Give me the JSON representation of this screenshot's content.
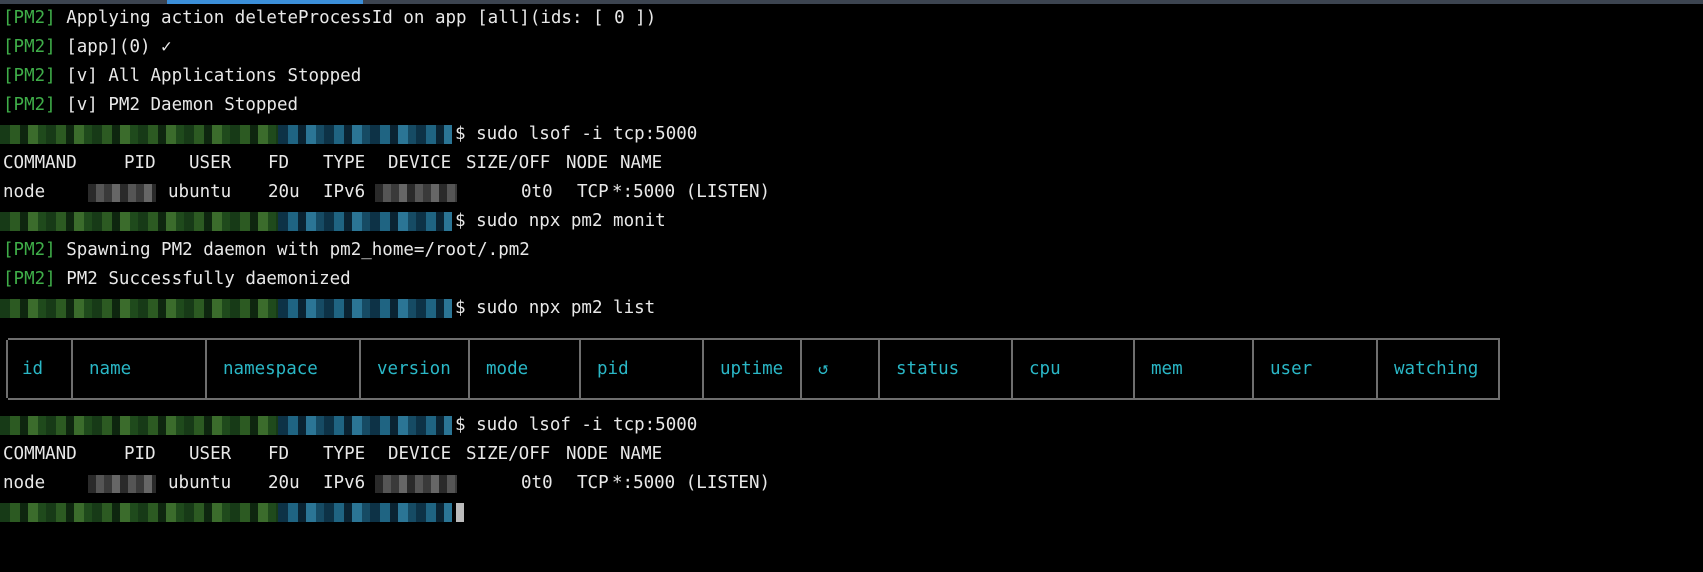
{
  "prefix": "[PM2]",
  "lines": [
    "Applying action deleteProcessId on app [all](ids: [ 0 ])",
    "[app](0) ✓",
    "[v] All Applications Stopped",
    "[v] PM2 Daemon Stopped"
  ],
  "commands": [
    "$ sudo lsof -i tcp:5000",
    "$ sudo npx pm2 monit",
    "$ sudo npx pm2 list",
    "$ sudo lsof -i tcp:5000"
  ],
  "monit_output": [
    "Spawning PM2 daemon with pm2_home=/root/.pm2",
    "PM2 Successfully daemonized"
  ],
  "lsof": {
    "headers": [
      "COMMAND",
      "PID",
      "USER",
      "FD",
      "TYPE",
      "DEVICE",
      "SIZE/OFF",
      "NODE",
      "NAME"
    ],
    "row": {
      "command": "node",
      "user": "ubuntu",
      "fd": "20u",
      "type": "IPv6",
      "size": "0t0",
      "node": "TCP",
      "name": "*:5000 (LISTEN)"
    }
  },
  "pm2_table": {
    "headers": [
      "id",
      "name",
      "namespace",
      "version",
      "mode",
      "pid",
      "uptime",
      "↺",
      "status",
      "cpu",
      "mem",
      "user",
      "watching"
    ]
  },
  "colors": {
    "prefix": "#3fae49",
    "header": "#2ab7c6",
    "text": "#e8e8e8"
  }
}
